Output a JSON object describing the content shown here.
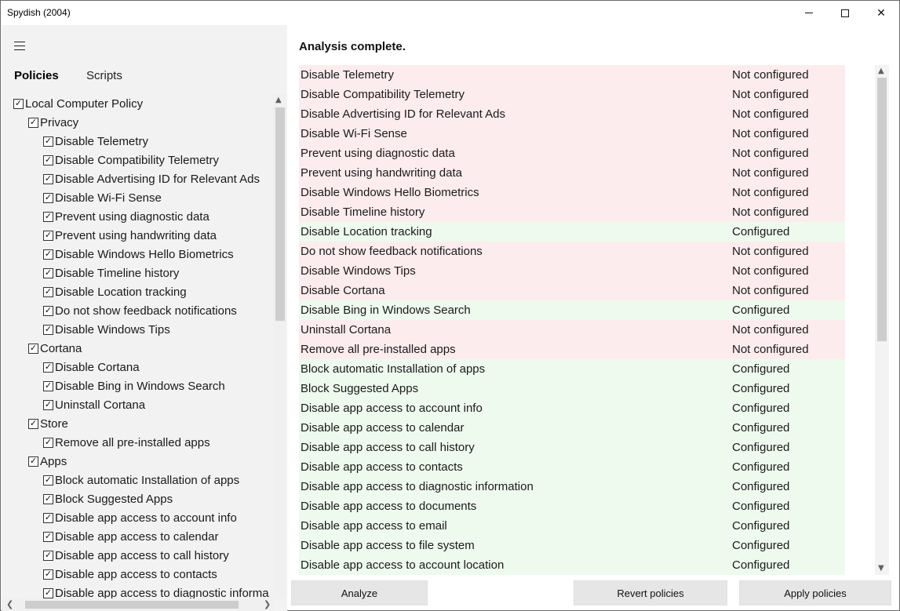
{
  "window": {
    "title": "Spydish (2004)",
    "controls": {
      "minimize": "–",
      "maximize": "□",
      "close": "✕"
    }
  },
  "left_pane": {
    "tabs": [
      "Policies",
      "Scripts"
    ],
    "active_tab": "Policies",
    "tree": [
      {
        "label": "Local Computer Policy",
        "level": 0,
        "checked": true
      },
      {
        "label": "Privacy",
        "level": 1,
        "checked": true
      },
      {
        "label": "Disable Telemetry",
        "level": 2,
        "checked": true
      },
      {
        "label": "Disable Compatibility Telemetry",
        "level": 2,
        "checked": true
      },
      {
        "label": "Disable Advertising ID for Relevant Ads",
        "level": 2,
        "checked": true
      },
      {
        "label": "Disable Wi-Fi Sense",
        "level": 2,
        "checked": true
      },
      {
        "label": "Prevent using diagnostic data",
        "level": 2,
        "checked": true
      },
      {
        "label": "Prevent using handwriting data",
        "level": 2,
        "checked": true
      },
      {
        "label": "Disable Windows Hello Biometrics",
        "level": 2,
        "checked": true
      },
      {
        "label": "Disable Timeline history",
        "level": 2,
        "checked": true
      },
      {
        "label": "Disable Location tracking",
        "level": 2,
        "checked": true
      },
      {
        "label": "Do not show feedback notifications",
        "level": 2,
        "checked": true
      },
      {
        "label": "Disable Windows Tips",
        "level": 2,
        "checked": true
      },
      {
        "label": "Cortana",
        "level": 1,
        "checked": true
      },
      {
        "label": "Disable Cortana",
        "level": 2,
        "checked": true
      },
      {
        "label": "Disable Bing in Windows Search",
        "level": 2,
        "checked": true
      },
      {
        "label": "Uninstall Cortana",
        "level": 2,
        "checked": true
      },
      {
        "label": "Store",
        "level": 1,
        "checked": true
      },
      {
        "label": "Remove all pre-installed apps",
        "level": 2,
        "checked": true
      },
      {
        "label": "Apps",
        "level": 1,
        "checked": true
      },
      {
        "label": "Block automatic Installation of apps",
        "level": 2,
        "checked": true
      },
      {
        "label": "Block Suggested Apps",
        "level": 2,
        "checked": true
      },
      {
        "label": "Disable app access to account info",
        "level": 2,
        "checked": true
      },
      {
        "label": "Disable app access to calendar",
        "level": 2,
        "checked": true
      },
      {
        "label": "Disable app access to call history",
        "level": 2,
        "checked": true
      },
      {
        "label": "Disable app access to contacts",
        "level": 2,
        "checked": true
      },
      {
        "label": "Disable app access to diagnostic informa",
        "level": 2,
        "checked": true
      }
    ]
  },
  "right_pane": {
    "status": "Analysis complete.",
    "results": [
      {
        "name": "Disable Telemetry",
        "state": "Not configured",
        "configured": false
      },
      {
        "name": "Disable Compatibility Telemetry",
        "state": "Not configured",
        "configured": false
      },
      {
        "name": "Disable Advertising ID for Relevant Ads",
        "state": "Not configured",
        "configured": false
      },
      {
        "name": "Disable Wi-Fi Sense",
        "state": "Not configured",
        "configured": false
      },
      {
        "name": "Prevent using diagnostic data",
        "state": "Not configured",
        "configured": false
      },
      {
        "name": "Prevent using handwriting data",
        "state": "Not configured",
        "configured": false
      },
      {
        "name": "Disable Windows Hello Biometrics",
        "state": "Not configured",
        "configured": false
      },
      {
        "name": "Disable Timeline history",
        "state": "Not configured",
        "configured": false
      },
      {
        "name": "Disable Location tracking",
        "state": "Configured",
        "configured": true
      },
      {
        "name": "Do not show feedback notifications",
        "state": "Not configured",
        "configured": false
      },
      {
        "name": "Disable Windows Tips",
        "state": "Not configured",
        "configured": false
      },
      {
        "name": "Disable Cortana",
        "state": "Not configured",
        "configured": false
      },
      {
        "name": "Disable Bing in Windows Search",
        "state": "Configured",
        "configured": true
      },
      {
        "name": "Uninstall Cortana",
        "state": "Not configured",
        "configured": false
      },
      {
        "name": "Remove all pre-installed apps",
        "state": "Not configured",
        "configured": false
      },
      {
        "name": "Block automatic Installation of apps",
        "state": "Configured",
        "configured": true
      },
      {
        "name": "Block Suggested Apps",
        "state": "Configured",
        "configured": true
      },
      {
        "name": "Disable app access to account info",
        "state": "Configured",
        "configured": true
      },
      {
        "name": "Disable app access to calendar",
        "state": "Configured",
        "configured": true
      },
      {
        "name": "Disable app access to call history",
        "state": "Configured",
        "configured": true
      },
      {
        "name": "Disable app access to contacts",
        "state": "Configured",
        "configured": true
      },
      {
        "name": "Disable app access to diagnostic information",
        "state": "Configured",
        "configured": true
      },
      {
        "name": "Disable app access to documents",
        "state": "Configured",
        "configured": true
      },
      {
        "name": "Disable app access to email",
        "state": "Configured",
        "configured": true
      },
      {
        "name": "Disable app access to file system",
        "state": "Configured",
        "configured": true
      },
      {
        "name": "Disable app access to account location",
        "state": "Configured",
        "configured": true
      }
    ],
    "colors": {
      "not_configured_bg": "#fdecee",
      "configured_bg": "#eefaee"
    }
  },
  "buttons": {
    "analyze": "Analyze",
    "revert": "Revert policies",
    "apply": "Apply policies"
  },
  "icons": {
    "menu": "hamburger-icon",
    "checkbox_mark": "✓",
    "scroll_up": "▲",
    "scroll_down": "▼",
    "scroll_left": "❮",
    "scroll_right": "❯"
  }
}
